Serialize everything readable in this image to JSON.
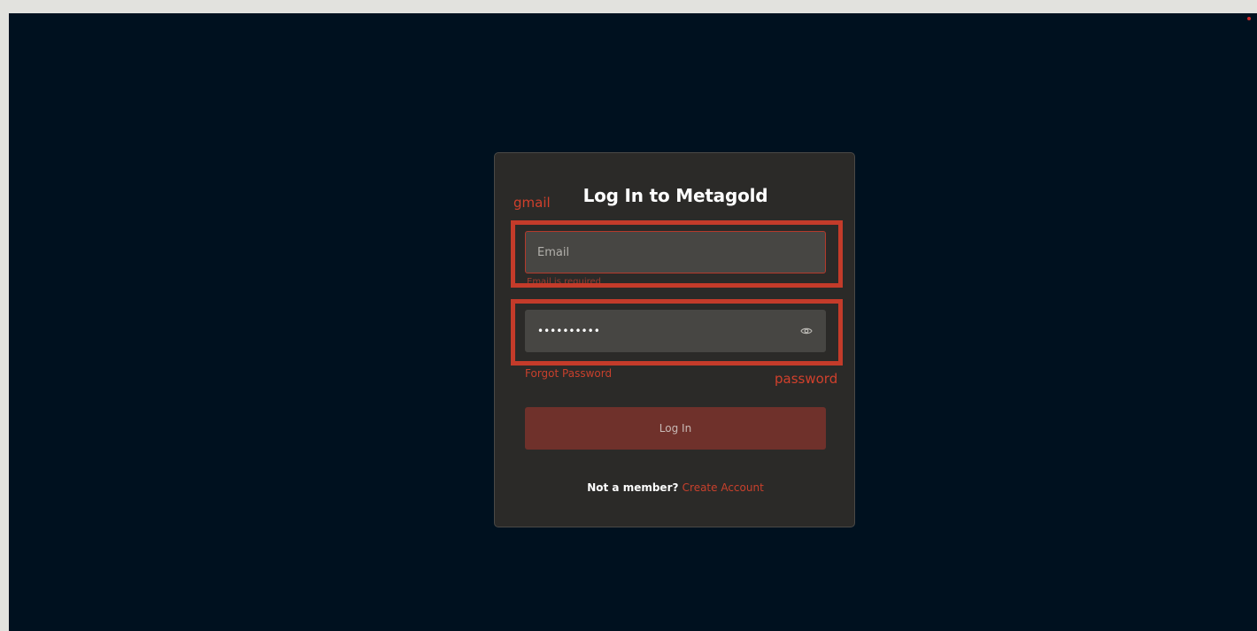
{
  "login": {
    "title": "Log In to Metagold",
    "email_placeholder": "Email",
    "email_error": "Email is required",
    "password_value": "••••••••••",
    "forgot_password": "Forgot Password",
    "login_button": "Log In",
    "not_member": "Not a member?",
    "create_account": "Create Account"
  },
  "annotations": {
    "email_label": "gmail",
    "password_label": "password"
  },
  "colors": {
    "page_bg": "#00111f",
    "card_bg": "#2b2a28",
    "accent": "#c8402c",
    "button_bg": "#6f312b",
    "highlight_border": "#c43b2a"
  },
  "icons": {
    "password_toggle": "eye-icon"
  }
}
